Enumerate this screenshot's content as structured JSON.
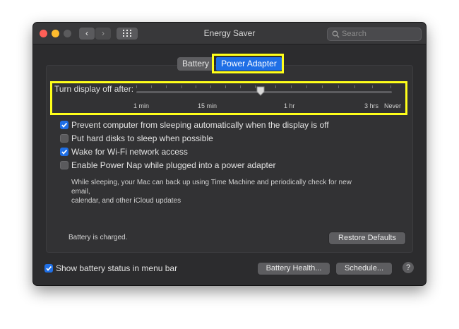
{
  "window": {
    "title": "Energy Saver",
    "search_placeholder": "Search",
    "nav_back_label": "‹",
    "nav_forward_label": "›",
    "icons": [
      "close-button",
      "minimize-button",
      "zoom-button",
      "chevron-left-icon",
      "chevron-right-icon",
      "grid-icon",
      "magnifier-icon"
    ]
  },
  "tabs": [
    {
      "label": "Battery",
      "selected": false
    },
    {
      "label": "Power Adapter",
      "selected": true
    }
  ],
  "display_sleep": {
    "label": "Turn display off after:",
    "ticks": [
      "1 min",
      "15 min",
      "1 hr",
      "3 hrs",
      "Never"
    ],
    "value": "1 hr"
  },
  "options": [
    {
      "label": "Prevent computer from sleeping automatically when the display is off",
      "checked": true
    },
    {
      "label": "Put hard disks to sleep when possible",
      "checked": false
    },
    {
      "label": "Wake for Wi-Fi network access",
      "checked": true
    },
    {
      "label": "Enable Power Nap while plugged into a power adapter",
      "checked": false
    }
  ],
  "power_nap_description_line1": "While sleeping, your Mac can back up using Time Machine and periodically check for new email,",
  "power_nap_description_line2": "calendar, and other iCloud updates",
  "status": "Battery is charged.",
  "buttons": {
    "restore": "Restore Defaults",
    "health": "Battery Health...",
    "schedule": "Schedule...",
    "help": "?"
  },
  "menu_option": {
    "label": "Show battery status in menu bar",
    "checked": true
  },
  "colors": {
    "highlight": "#ffff1a",
    "accent": "#1f6fe6",
    "window_bg": "#2c2c2e"
  }
}
